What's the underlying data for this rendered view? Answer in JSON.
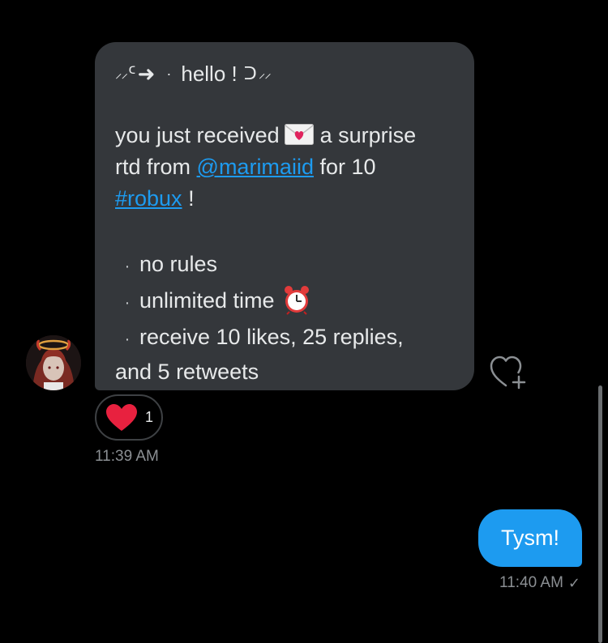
{
  "conversation": {
    "incoming_message": {
      "deco_open_small": "⸝⸝",
      "deco_c": "ᑦ",
      "deco_arrow": "➜",
      "deco_dot": "·",
      "greeting": "hello !",
      "deco_close": "ᑐ",
      "deco_close_small": "⸝⸝",
      "line1_a": "you just received",
      "envelope_icon": "love-letter-envelope-icon",
      "line1_b": "a surprise",
      "line2_a": "rtd from",
      "mention": "@marimaiid",
      "line2_b": "for 10",
      "hashtag": "#robux",
      "line3_b": " !",
      "bullet": "·",
      "rule1": "no rules",
      "rule2": "unlimited time",
      "clock_icon": "alarm-clock-icon",
      "rule3": "receive 10 likes, 25 replies,",
      "rule3_cont": "and 5 retweets",
      "reaction_icon": "red-heart-icon",
      "reaction_count": "1",
      "timestamp": "11:39 AM"
    },
    "outgoing_message": {
      "text": "Tysm!",
      "timestamp": "11:40 AM",
      "status_icon": "✓"
    }
  },
  "colors": {
    "background": "#000000",
    "incoming_bubble": "#34373b",
    "outgoing_bubble": "#1d9bf0",
    "link": "#1d9bf0",
    "muted_text": "#8b8f93",
    "heart": "#e8213f"
  }
}
